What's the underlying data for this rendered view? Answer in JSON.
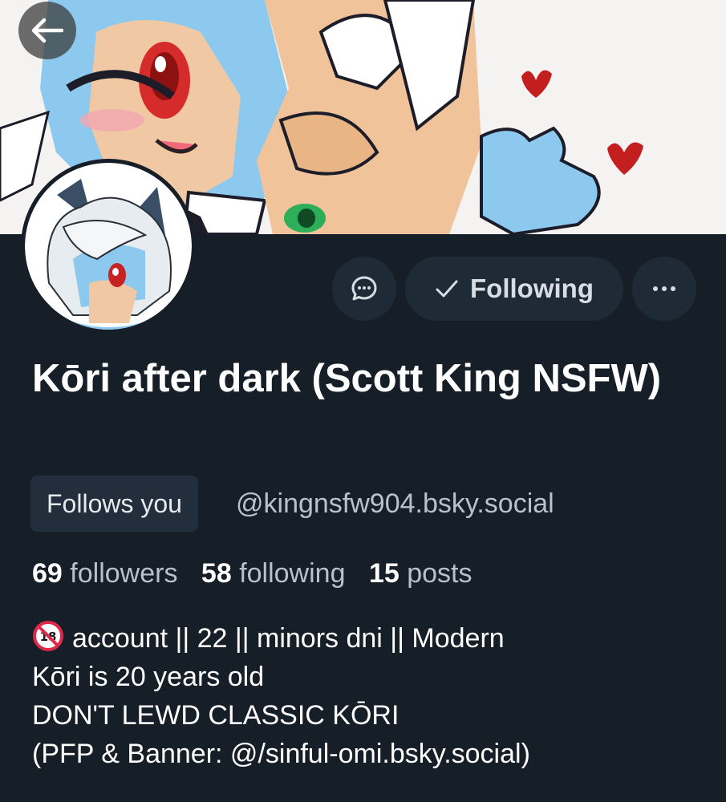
{
  "profile": {
    "display_name": "Kōri after dark (Scott King NSFW)",
    "follows_you_label": "Follows you",
    "handle": "@kingnsfw904.bsky.social",
    "following_button_label": "Following",
    "stats": {
      "followers_count": "69",
      "followers_label": "followers",
      "following_count": "58",
      "following_label": "following",
      "posts_count": "15",
      "posts_label": "posts"
    },
    "bio": {
      "line1": "account || 22 || minors dni || Modern",
      "line2": "Kōri is 20 years old",
      "line3": "DON'T LEWD CLASSIC KŌRI",
      "line4": "(PFP & Banner: @/sinful-omi.bsky.social)"
    }
  },
  "icons": {
    "back": "arrow-left-icon",
    "message": "chat-bubble-icon",
    "following_check": "checkmark-icon",
    "more": "ellipsis-icon",
    "no_under_18": "no-under-18-icon"
  },
  "colors": {
    "background": "#161e27",
    "button_bg": "#1e2a36",
    "badge_bg": "#222e3b",
    "muted_text": "#b8c2cd",
    "text": "#ffffff"
  }
}
